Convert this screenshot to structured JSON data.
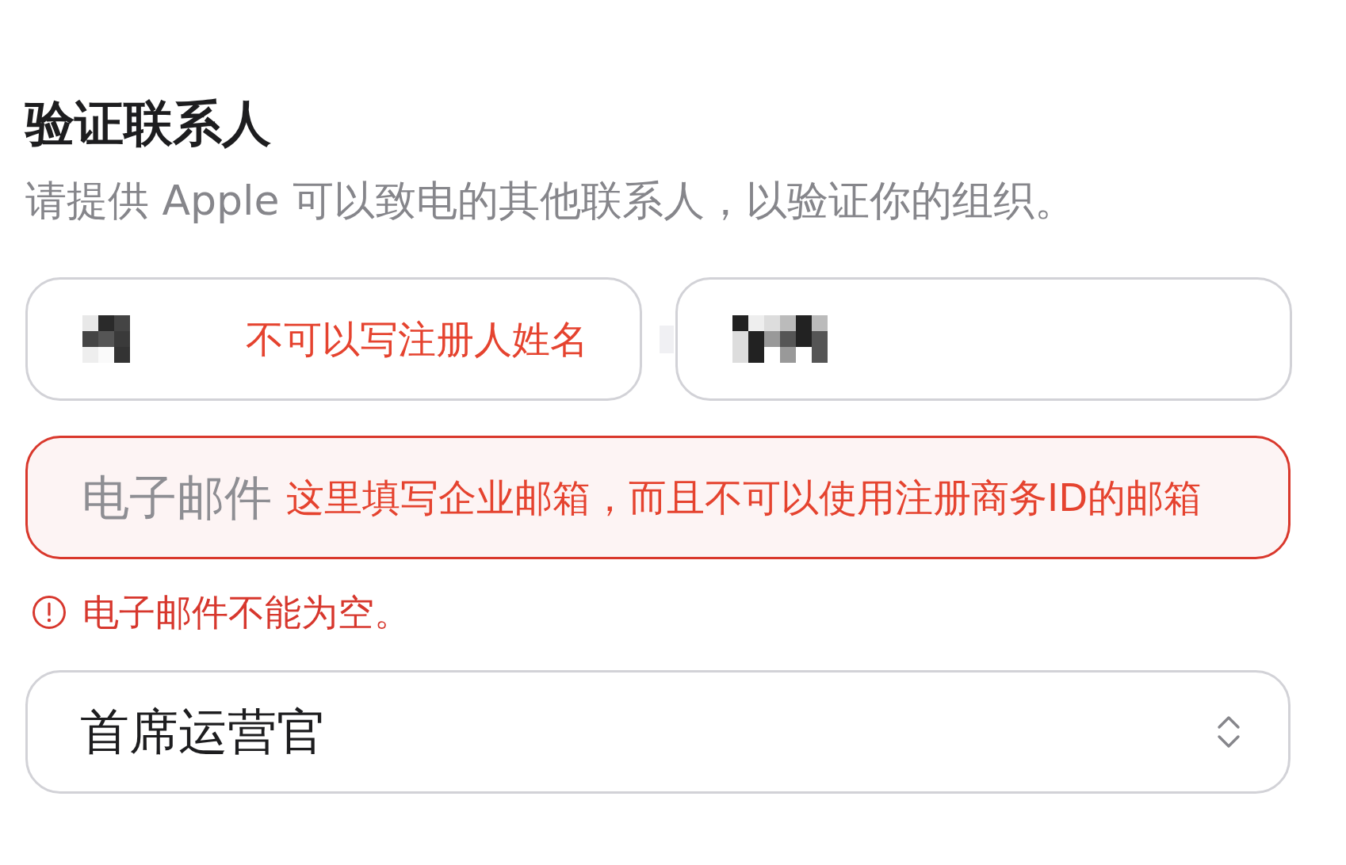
{
  "section": {
    "title": "验证联系人",
    "description": "请提供 Apple 可以致电的其他联系人，以验证你的组织。"
  },
  "name_fields": [
    {
      "kind": "redacted",
      "annotation": "不可以写注册人姓名"
    },
    {
      "kind": "redacted"
    }
  ],
  "email_field": {
    "placeholder": "电子邮件",
    "annotation": "这里填写企业邮箱，而且不可以使用注册商务ID的邮箱",
    "invalid": true,
    "error": "电子邮件不能为空。"
  },
  "role_select": {
    "value": "首席运营官"
  }
}
